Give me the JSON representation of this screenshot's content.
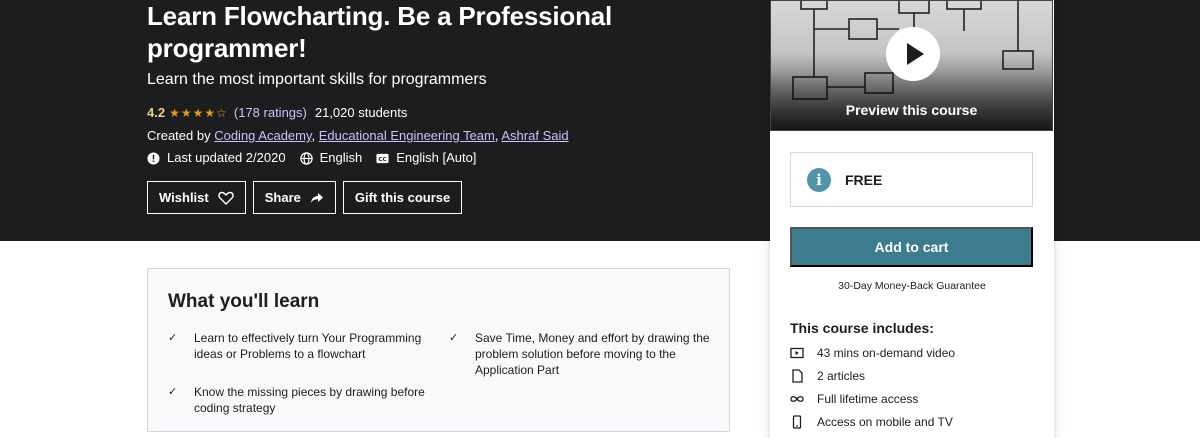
{
  "course": {
    "title": "Learn Flowcharting. Be a Professional programmer!",
    "subtitle": "Learn the most important skills for programmers",
    "rating": "4.2",
    "stars": "★★★★☆",
    "ratings_count": "(178 ratings)",
    "students": "21,020 students",
    "created_by_label": "Created by",
    "authors": [
      "Coding Academy",
      "Educational Engineering Team",
      "Ashraf Said"
    ],
    "last_updated": "Last updated 2/2020",
    "language": "English",
    "captions": "English [Auto]"
  },
  "actions": {
    "wishlist": "Wishlist",
    "share": "Share",
    "gift": "Gift this course"
  },
  "sidebar": {
    "preview_label": "Preview this course",
    "price": "FREE",
    "add_to_cart": "Add to cart",
    "guarantee": "30-Day Money-Back Guarantee",
    "includes_title": "This course includes:",
    "includes": [
      {
        "icon": "video-icon",
        "text": "43 mins on-demand video"
      },
      {
        "icon": "file-icon",
        "text": "2 articles"
      },
      {
        "icon": "infinity-icon",
        "text": "Full lifetime access"
      },
      {
        "icon": "mobile-icon",
        "text": "Access on mobile and TV"
      }
    ]
  },
  "learn": {
    "title": "What you'll learn",
    "items": [
      "Learn to effectively turn Your Programming ideas or Problems to a flowchart",
      "Save Time, Money and effort by drawing the problem solution before moving to the Application Part",
      "Know the missing pieces by drawing before coding strategy"
    ]
  },
  "colors": {
    "hero_bg": "#1c1d1f",
    "rating": "#f3ca8c",
    "star": "#e59819",
    "link": "#cec0fc",
    "cart": "#3d7b8e",
    "info": "#5294a9"
  }
}
